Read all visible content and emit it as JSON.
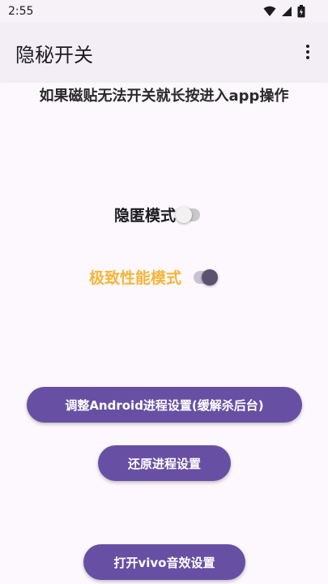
{
  "status_bar": {
    "time": "2:55",
    "icons": [
      "wifi-icon",
      "signal-icon",
      "battery-icon"
    ]
  },
  "app_bar": {
    "title": "隐秘开关",
    "menu_icon": "more-vert-icon"
  },
  "hint_text": "如果磁贴无法开关就长按进入app操作",
  "toggles": [
    {
      "label": "隐匿模式",
      "label_color": "#1c1b1f",
      "checked": false
    },
    {
      "label": "极致性能模式",
      "label_color": "#f4b63a",
      "checked": true
    }
  ],
  "buttons": [
    {
      "label": "调整Android进程设置(缓解杀后台)"
    },
    {
      "label": "还原进程设置"
    },
    {
      "label": "打开vivo音效设置"
    }
  ],
  "colors": {
    "primary": "#6750a4",
    "background": "#fdf8fd",
    "switch_on_thumb": "#5a5370",
    "switch_off_thumb": "#f2f2f2"
  }
}
